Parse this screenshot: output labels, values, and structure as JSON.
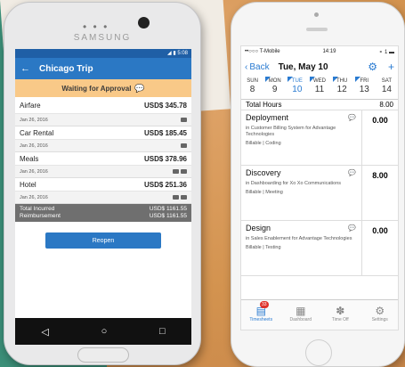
{
  "android": {
    "brand": "SAMSUNG",
    "status_time": "5:08",
    "header": {
      "back": "←",
      "title": "Chicago Trip"
    },
    "banner": {
      "text": "Waiting for Approval"
    },
    "expenses": [
      {
        "name": "Airfare",
        "amount": "USD$ 345.78",
        "date": "Jan 26, 2016"
      },
      {
        "name": "Car Rental",
        "amount": "USD$ 185.45",
        "date": "Jan 26, 2016"
      },
      {
        "name": "Meals",
        "amount": "USD$ 378.96",
        "date": "Jan 26, 2016"
      },
      {
        "name": "Hotel",
        "amount": "USD$ 251.36",
        "date": "Jan 26, 2016"
      }
    ],
    "totals": {
      "incurred_label": "Total Incurred",
      "incurred_value": "USD$ 1161.55",
      "reimb_label": "Reimbursement",
      "reimb_value": "USD$ 1161.55"
    },
    "reopen_label": "Reopen",
    "nav": {
      "back": "◁",
      "home": "○",
      "recent": "□"
    }
  },
  "iphone": {
    "status": {
      "carrier": "••○○○ T-Mobile",
      "time": "14:19",
      "right": "⚬ 1 ▬"
    },
    "nav": {
      "back": "Back",
      "title": "Tue, May 10",
      "plus": "+"
    },
    "week": [
      {
        "dow": "SUN",
        "num": "8"
      },
      {
        "dow": "MON",
        "num": "9"
      },
      {
        "dow": "TUE",
        "num": "10"
      },
      {
        "dow": "WED",
        "num": "11"
      },
      {
        "dow": "THU",
        "num": "12"
      },
      {
        "dow": "FRI",
        "num": "13"
      },
      {
        "dow": "SAT",
        "num": "14"
      }
    ],
    "total": {
      "label": "Total Hours",
      "value": "8.00"
    },
    "entries": [
      {
        "name": "Deployment",
        "desc": "in Customer Billing System for Advantage Technologies",
        "tags": "Billable | Coding",
        "hours": "0.00"
      },
      {
        "name": "Discovery",
        "desc": "in Dashboarding for Xo Xo Communications",
        "tags": "Billable | Meeting",
        "hours": "8.00"
      },
      {
        "name": "Design",
        "desc": "in Sales Enablement for Advantage Technologies",
        "tags": "Billable | Testing",
        "hours": "0.00"
      }
    ],
    "tabs": [
      {
        "label": "Timesheets",
        "badge": "33"
      },
      {
        "label": "Dashboard"
      },
      {
        "label": "Time Off"
      },
      {
        "label": "Settings"
      }
    ]
  }
}
